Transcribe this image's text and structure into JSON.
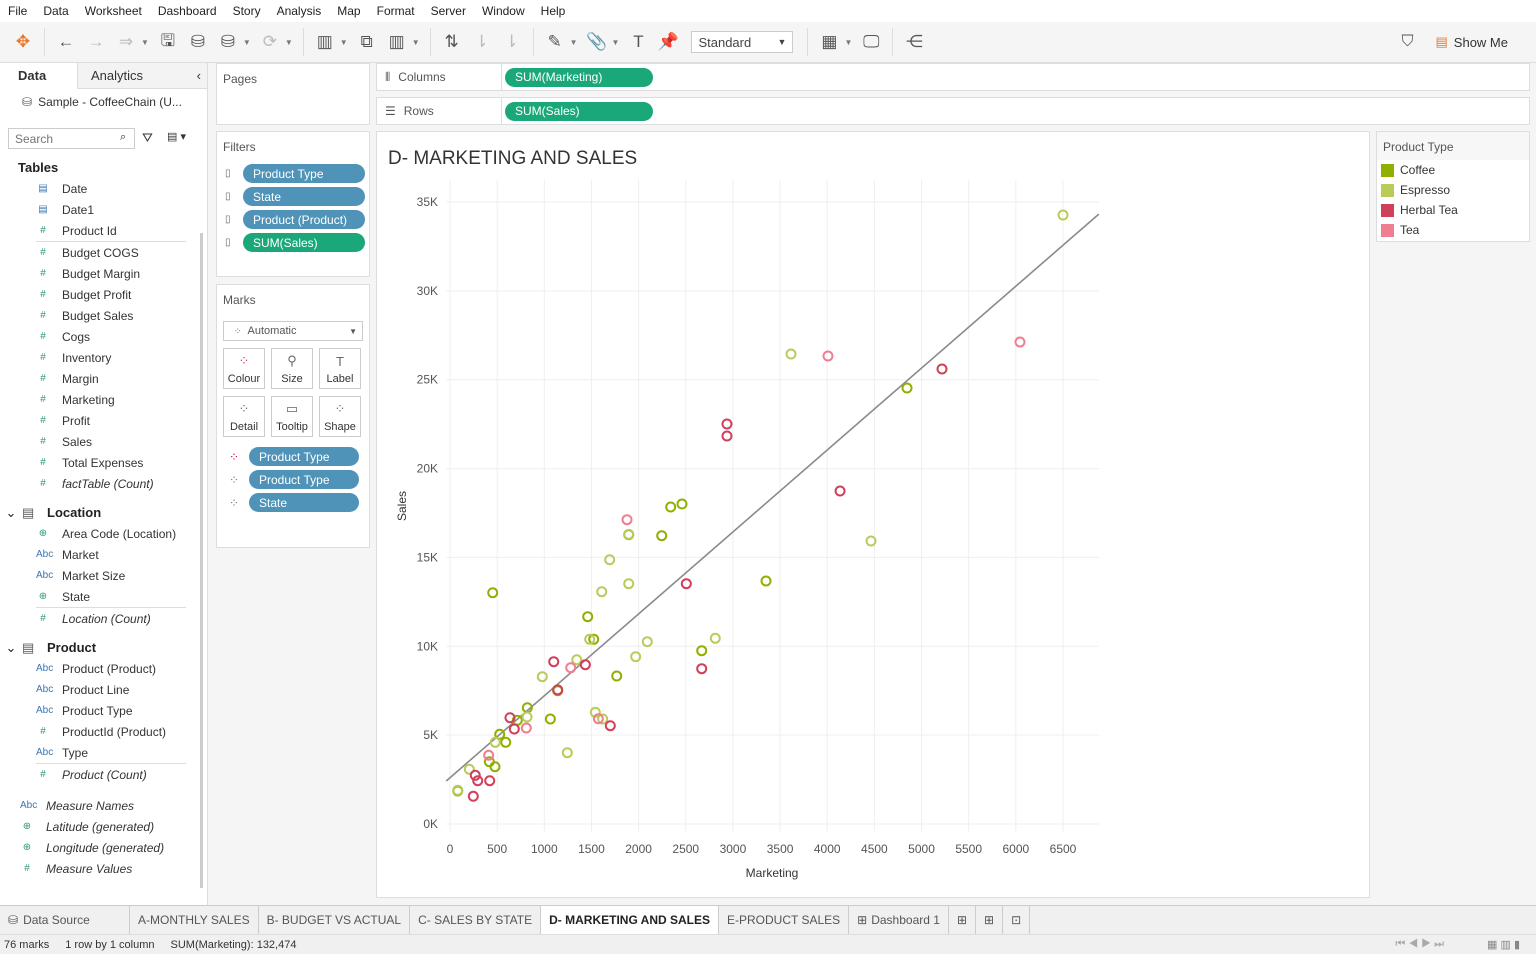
{
  "menu": [
    "File",
    "Data",
    "Worksheet",
    "Dashboard",
    "Story",
    "Analysis",
    "Map",
    "Format",
    "Server",
    "Window",
    "Help"
  ],
  "toolbar": {
    "fit_value": "Standard",
    "show_me": "Show Me"
  },
  "data_pane": {
    "tabs": [
      "Data",
      "Analytics"
    ],
    "data_source": "Sample - CoffeeChain (U...",
    "search_placeholder": "Search",
    "groups": [
      {
        "header": "Tables",
        "items": [
          {
            "label": "Date",
            "type": "date"
          },
          {
            "label": "Date1",
            "type": "date"
          },
          {
            "label": "Product Id",
            "type": "measure"
          },
          {
            "divider": true
          },
          {
            "label": "Budget COGS",
            "type": "measure"
          },
          {
            "label": "Budget Margin",
            "type": "measure"
          },
          {
            "label": "Budget Profit",
            "type": "measure"
          },
          {
            "label": "Budget Sales",
            "type": "measure"
          },
          {
            "label": "Cogs",
            "type": "measure"
          },
          {
            "label": "Inventory",
            "type": "measure"
          },
          {
            "label": "Margin",
            "type": "measure"
          },
          {
            "label": "Marketing",
            "type": "measure"
          },
          {
            "label": "Profit",
            "type": "measure"
          },
          {
            "label": "Sales",
            "type": "measure"
          },
          {
            "label": "Total Expenses",
            "type": "measure"
          },
          {
            "label": "factTable (Count)",
            "type": "measure",
            "italic": true
          }
        ]
      },
      {
        "header": "Location",
        "items": [
          {
            "label": "Area Code (Location)",
            "type": "geo"
          },
          {
            "label": "Market",
            "type": "string"
          },
          {
            "label": "Market Size",
            "type": "string"
          },
          {
            "label": "State",
            "type": "geo"
          },
          {
            "divider": true
          },
          {
            "label": "Location (Count)",
            "type": "measure",
            "italic": true
          }
        ]
      },
      {
        "header": "Product",
        "items": [
          {
            "label": "Product (Product)",
            "type": "string"
          },
          {
            "label": "Product Line",
            "type": "string"
          },
          {
            "label": "Product Type",
            "type": "string"
          },
          {
            "label": "ProductId (Product)",
            "type": "measure"
          },
          {
            "label": "Type",
            "type": "string"
          },
          {
            "divider": true
          },
          {
            "label": "Product (Count)",
            "type": "measure",
            "italic": true
          }
        ]
      },
      {
        "header": "",
        "items": [
          {
            "label": "Measure Names",
            "type": "string",
            "italic": true,
            "top": true
          },
          {
            "label": "Latitude (generated)",
            "type": "geo",
            "italic": true,
            "top": true
          },
          {
            "label": "Longitude (generated)",
            "type": "geo",
            "italic": true,
            "top": true
          },
          {
            "label": "Measure Values",
            "type": "measure",
            "italic": true,
            "top": true
          }
        ]
      }
    ]
  },
  "pages": {
    "title": "Pages"
  },
  "filters": {
    "title": "Filters",
    "pills": [
      {
        "label": "Product Type",
        "color": "blue"
      },
      {
        "label": "State",
        "color": "blue"
      },
      {
        "label": "Product (Product)",
        "color": "blue"
      },
      {
        "label": "SUM(Sales)",
        "color": "green"
      }
    ]
  },
  "marks": {
    "title": "Marks",
    "type": "Automatic",
    "buttons": [
      "Colour",
      "Size",
      "Label",
      "Detail",
      "Tooltip",
      "Shape"
    ],
    "pills": [
      "Product Type",
      "Product Type",
      "State"
    ]
  },
  "shelves": {
    "columns_label": "Columns",
    "columns_pill": "SUM(Marketing)",
    "rows_label": "Rows",
    "rows_pill": "SUM(Sales)"
  },
  "legend": {
    "title": "Product Type",
    "items": [
      {
        "label": "Coffee",
        "color": "#8fb000"
      },
      {
        "label": "Espresso",
        "color": "#bbcb5a"
      },
      {
        "label": "Herbal Tea",
        "color": "#d1405a"
      },
      {
        "label": "Tea",
        "color": "#f07d90"
      }
    ]
  },
  "chart_data": {
    "type": "scatter",
    "title": "D- MARKETING AND SALES",
    "xlabel": "Marketing",
    "ylabel": "Sales",
    "xlim": [
      -50,
      6900
    ],
    "ylim": [
      -500,
      36500
    ],
    "xticks": [
      0,
      500,
      1000,
      1500,
      2000,
      2500,
      3000,
      3500,
      4000,
      4500,
      5000,
      5500,
      6000,
      6500
    ],
    "yticks": [
      {
        "v": 0,
        "l": "0K"
      },
      {
        "v": 5000,
        "l": "5K"
      },
      {
        "v": 10000,
        "l": "10K"
      },
      {
        "v": 15000,
        "l": "15K"
      },
      {
        "v": 20000,
        "l": "20K"
      },
      {
        "v": 25000,
        "l": "25K"
      },
      {
        "v": 30000,
        "l": "30K"
      },
      {
        "v": 35000,
        "l": "35K"
      }
    ],
    "grid": true,
    "marker": "open-circle",
    "trend_line": [
      [
        -40,
        2420
      ],
      [
        6880,
        34320
      ]
    ],
    "series": [
      {
        "name": "Coffee",
        "color": "#8fb000",
        "points": [
          [
            453,
            13015
          ],
          [
            1460,
            11665
          ],
          [
            1524,
            10393
          ],
          [
            1895,
            16279
          ],
          [
            2245,
            16223
          ],
          [
            2340,
            17838
          ],
          [
            2460,
            18006
          ],
          [
            2669,
            9752
          ],
          [
            1768,
            8328
          ],
          [
            1142,
            7501
          ],
          [
            820,
            6544
          ],
          [
            714,
            5835
          ],
          [
            1064,
            5908
          ],
          [
            527,
            5047
          ],
          [
            591,
            4597
          ],
          [
            417,
            3506
          ],
          [
            477,
            3224
          ],
          [
            82,
            1857
          ],
          [
            4846,
            24534
          ],
          [
            3351,
            13674
          ]
        ]
      },
      {
        "name": "Espresso",
        "color": "#bbcb5a",
        "points": [
          [
            1481,
            10393
          ],
          [
            1693,
            14872
          ],
          [
            1609,
            13072
          ],
          [
            1895,
            13522
          ],
          [
            2092,
            10258
          ],
          [
            2813,
            10449
          ],
          [
            1969,
            9414
          ],
          [
            1344,
            9245
          ],
          [
            979,
            8289
          ],
          [
            817,
            6021
          ],
          [
            1541,
            6285
          ],
          [
            1619,
            5908
          ],
          [
            1244,
            4012
          ],
          [
            480,
            4597
          ],
          [
            205,
            3078
          ],
          [
            82,
            1900
          ],
          [
            1895,
            16300
          ],
          [
            6500,
            34268
          ],
          [
            3616,
            26447
          ],
          [
            4464,
            15924
          ]
        ]
      },
      {
        "name": "Herbal Tea",
        "color": "#d1405a",
        "points": [
          [
            2506,
            13522
          ],
          [
            2669,
            8739
          ],
          [
            1435,
            8964
          ],
          [
            1100,
            9133
          ],
          [
            1142,
            7550
          ],
          [
            636,
            5981
          ],
          [
            682,
            5346
          ],
          [
            1700,
            5531
          ],
          [
            268,
            2740
          ],
          [
            294,
            2436
          ],
          [
            421,
            2436
          ],
          [
            247,
            1559
          ],
          [
            5217,
            25603
          ],
          [
            2937,
            22508
          ],
          [
            2937,
            21833
          ],
          [
            4136,
            18738
          ]
        ]
      },
      {
        "name": "Tea",
        "color": "#f07d90",
        "points": [
          [
            1877,
            17123
          ],
          [
            1280,
            8795
          ],
          [
            809,
            5402
          ],
          [
            1573,
            5925
          ],
          [
            410,
            3866
          ],
          [
            4008,
            26334
          ],
          [
            6044,
            27122
          ]
        ]
      }
    ]
  },
  "sheet_tabs": {
    "data_source": "Data Source",
    "tabs": [
      "A-MONTHLY SALES",
      "B- BUDGET VS ACTUAL",
      "C- SALES BY STATE",
      "D- MARKETING AND SALES",
      "E-PRODUCT SALES",
      "Dashboard 1"
    ],
    "active": 3
  },
  "status": {
    "marks": "76 marks",
    "dims": "1 row by 1 column",
    "sum": "SUM(Marketing): 132,474"
  }
}
